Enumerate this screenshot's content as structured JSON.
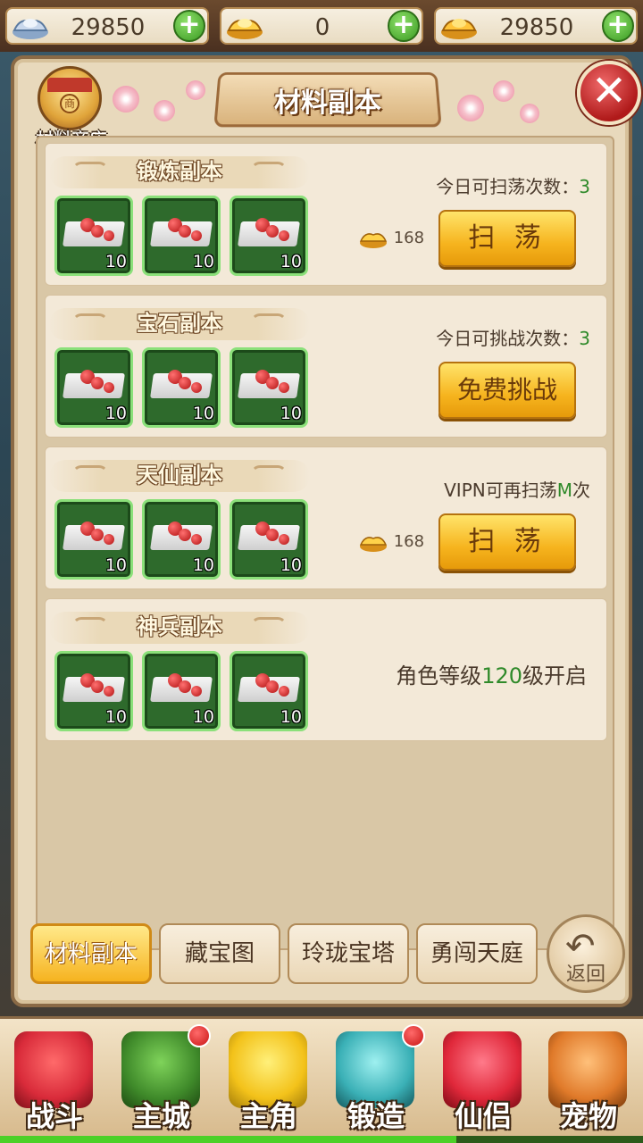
{
  "currency": [
    {
      "icon": "silver-ingot-icon",
      "value": "29850"
    },
    {
      "icon": "gold-ingot-icon",
      "value": "0"
    },
    {
      "icon": "gold-ingot-stack-icon",
      "value": "29850"
    }
  ],
  "header": {
    "title": "材料副本",
    "shop_label": "材料商店",
    "close": "✕"
  },
  "cards": [
    {
      "title": "锻炼副本",
      "info_label": "今日可扫荡次数：",
      "info_value": "3",
      "cost": "168",
      "button": "扫 荡",
      "items": [
        {
          "qty": "10"
        },
        {
          "qty": "10"
        },
        {
          "qty": "10"
        }
      ]
    },
    {
      "title": "宝石副本",
      "info_label": "今日可挑战次数：",
      "info_value": "3",
      "button": "免费挑战",
      "items": [
        {
          "qty": "10"
        },
        {
          "qty": "10"
        },
        {
          "qty": "10"
        }
      ]
    },
    {
      "title": "天仙副本",
      "info_label_pre": "VIPN可再扫荡",
      "info_value": "M",
      "info_label_post": "次",
      "cost": "168",
      "button": "扫 荡",
      "items": [
        {
          "qty": "10"
        },
        {
          "qty": "10"
        },
        {
          "qty": "10"
        }
      ]
    },
    {
      "title": "神兵副本",
      "lock_pre": "角色等级",
      "lock_value": "120",
      "lock_post": "级开启",
      "items": [
        {
          "qty": "10"
        },
        {
          "qty": "10"
        },
        {
          "qty": "10"
        }
      ]
    }
  ],
  "tabs": [
    "材料副本",
    "藏宝图",
    "玲珑宝塔",
    "勇闯天庭"
  ],
  "back": {
    "arrow": "↶",
    "label": "返回"
  },
  "nav": [
    {
      "label": "战斗",
      "icon": "battle-ninja-icon",
      "color": "#d92b3a",
      "badge": false
    },
    {
      "label": "主城",
      "icon": "city-gate-icon",
      "color": "#3f8a2a",
      "badge": true
    },
    {
      "label": "主角",
      "icon": "hero-face-icon",
      "color": "#f3c21a",
      "badge": false
    },
    {
      "label": "锻造",
      "icon": "forge-hammer-icon",
      "color": "#3ab0b6",
      "badge": true
    },
    {
      "label": "仙侣",
      "icon": "heart-partner-icon",
      "color": "#e0283a",
      "badge": false
    },
    {
      "label": "宠物",
      "icon": "monkey-pet-icon",
      "color": "#e07a2a",
      "badge": false
    }
  ],
  "progress": 0.71,
  "colors": {
    "accent_green": "#2f8a2a",
    "button_gold": "#f6b41e",
    "close_red": "#b01a1a"
  }
}
